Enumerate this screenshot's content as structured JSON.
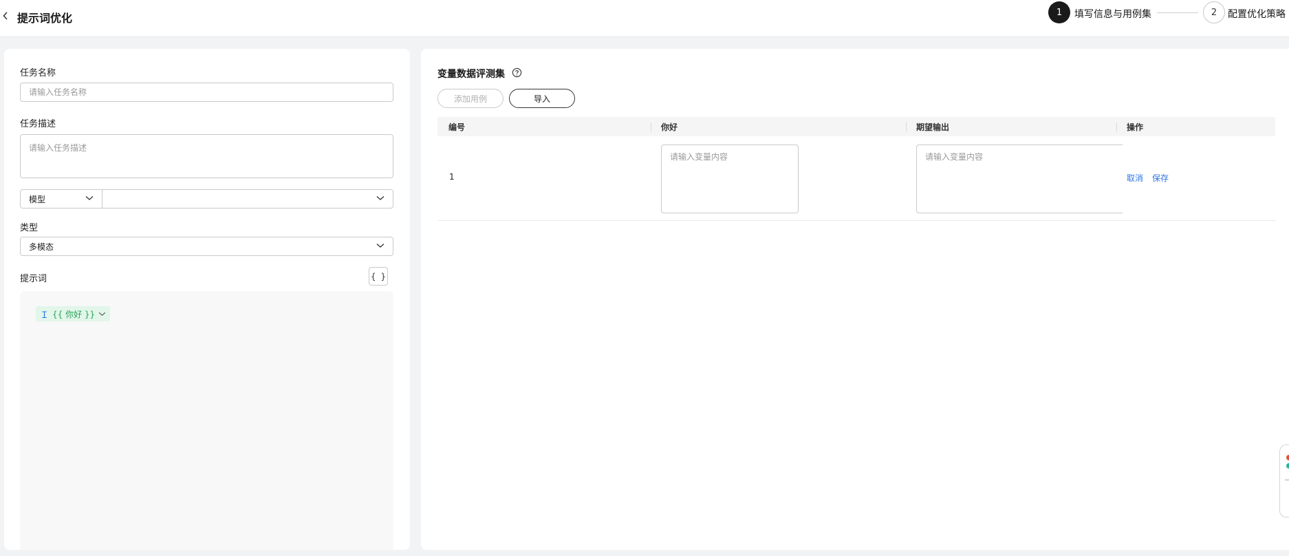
{
  "header": {
    "title": "提示词优化",
    "steps": [
      {
        "number": "1",
        "label": "填写信息与用例集"
      },
      {
        "number": "2",
        "label": "配置优化策略"
      }
    ]
  },
  "form": {
    "task_name_label": "任务名称",
    "task_name_placeholder": "请输入任务名称",
    "task_desc_label": "任务描述",
    "task_desc_placeholder": "请输入任务描述",
    "model_select_label": "模型",
    "model_value": "",
    "type_label": "类型",
    "type_value": "多模态",
    "prompt_label": "提示词",
    "var_button_label": "{ }",
    "variable_tag": "{{ 你好 }}"
  },
  "dataset": {
    "title": "变量数据评测集",
    "add_case_label": "添加用例",
    "import_label": "导入",
    "columns": [
      "编号",
      "你好",
      "期望输出",
      "操作"
    ],
    "rows": [
      {
        "number": "1",
        "var_placeholder": "请输入变量内容",
        "expected_placeholder": "请输入变量内容",
        "cancel_label": "取消",
        "save_label": "保存"
      }
    ]
  },
  "icons": {
    "back": "chevron-left-icon",
    "help": "help-circle-icon",
    "dropdown": "chevron-down-icon",
    "variable_type": "text-type-icon"
  },
  "colors": {
    "accent": "#2f74e8",
    "step_active": "#1a1a1a",
    "variable_tag_bg": "#e2f6ea",
    "variable_tag_text": "#2aa25a"
  }
}
